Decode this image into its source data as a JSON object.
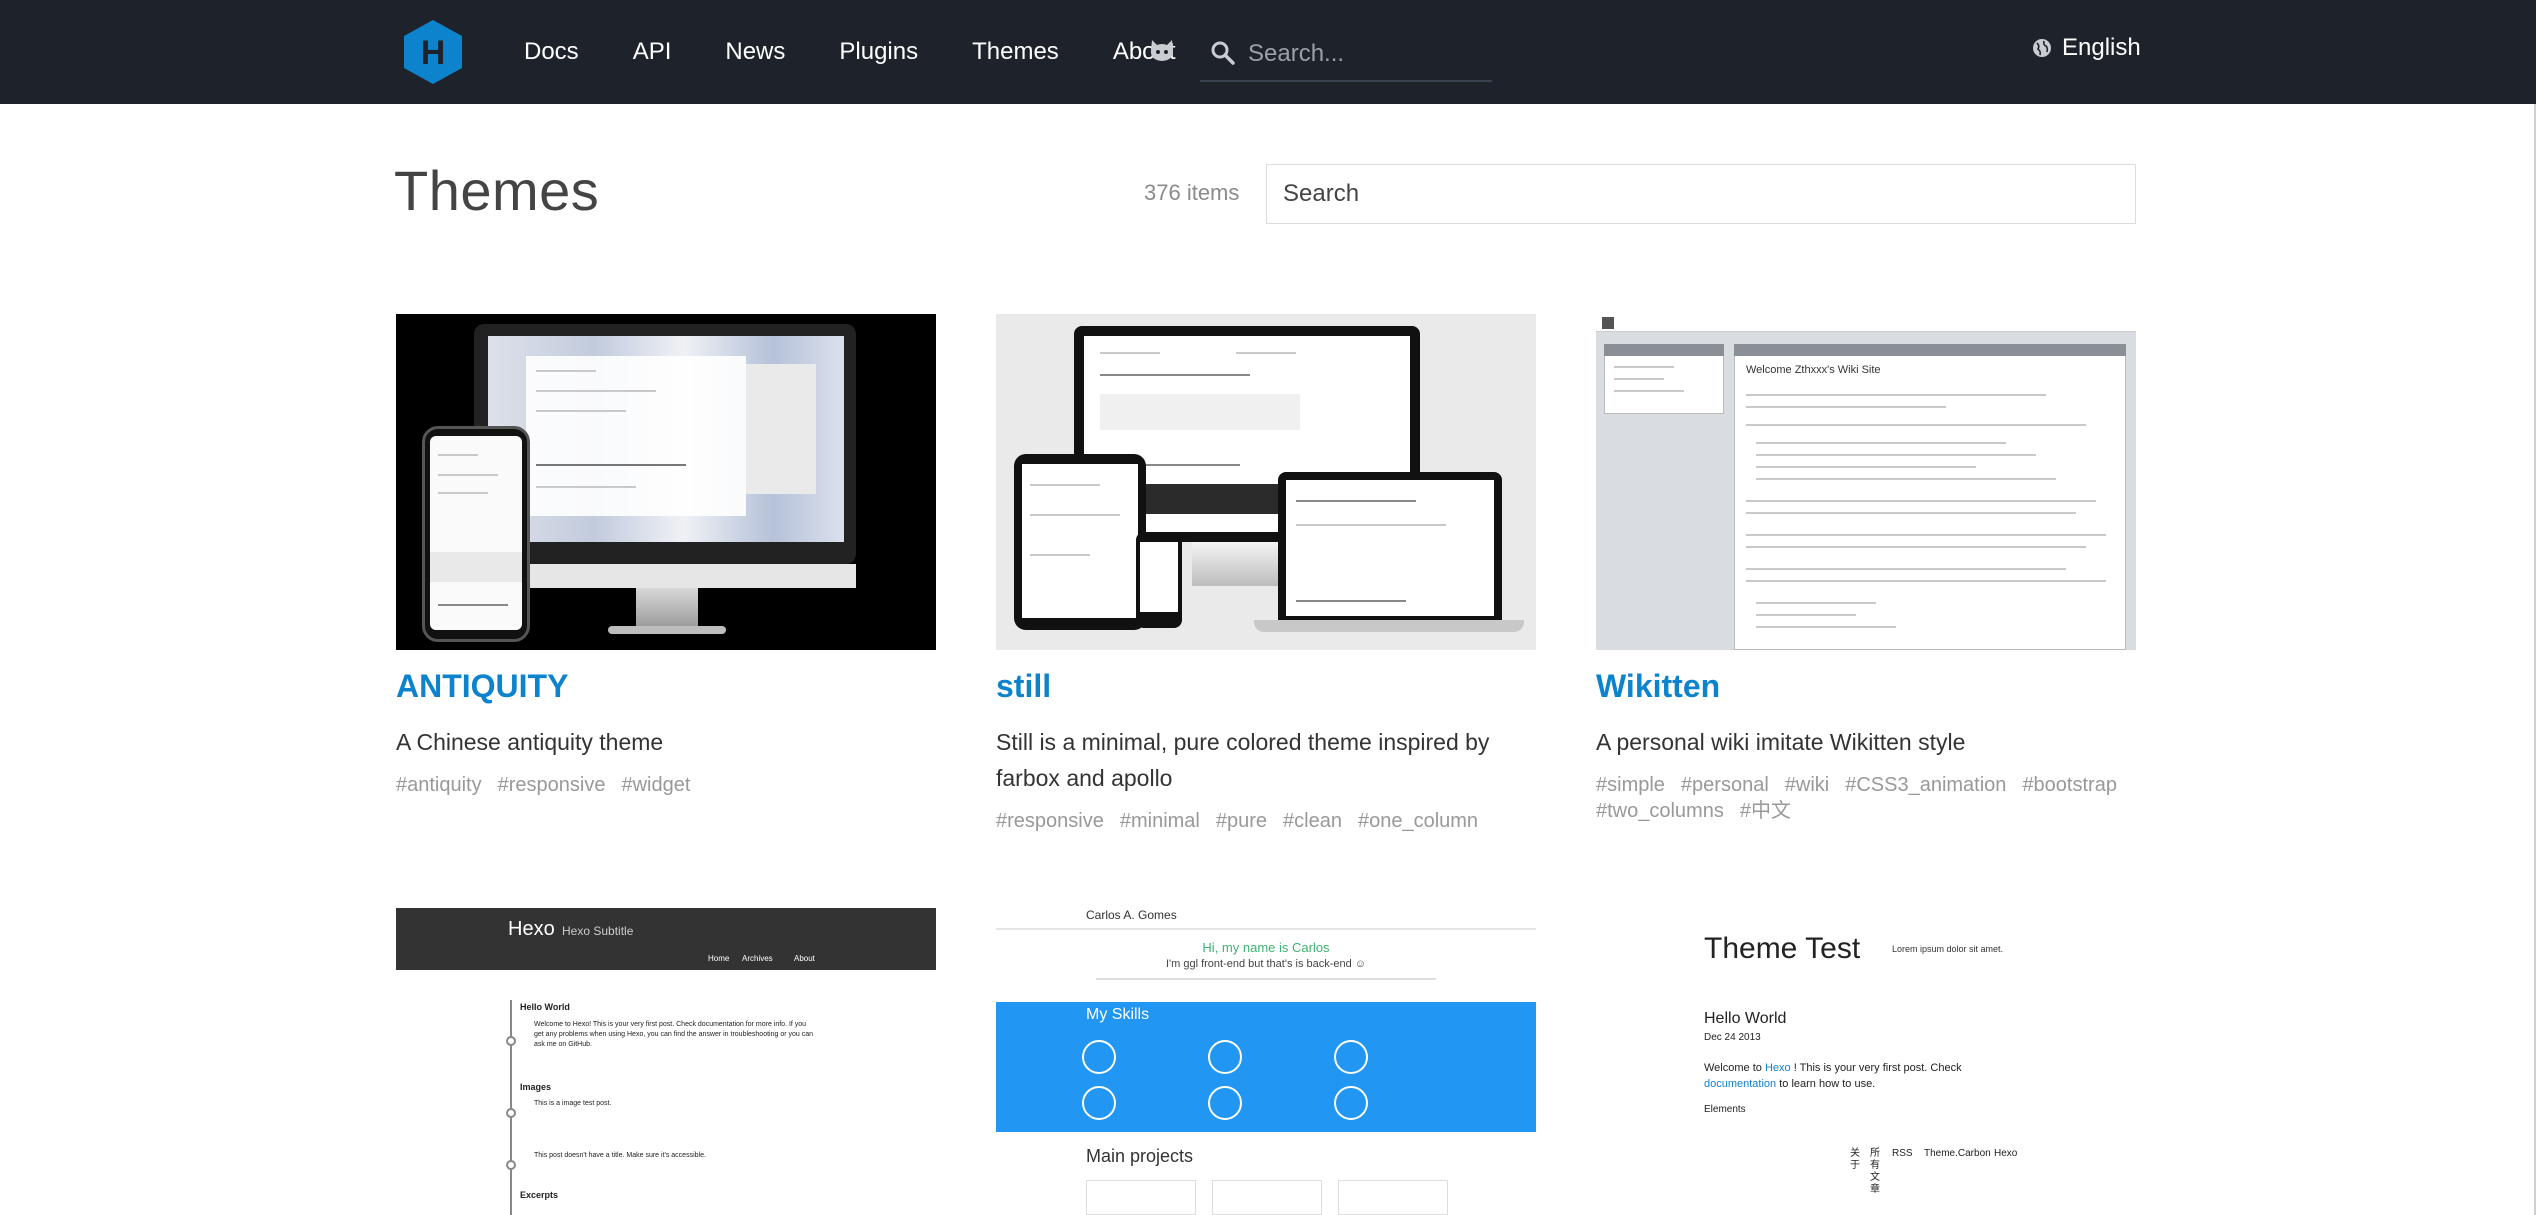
{
  "header": {
    "logo_letter": "H",
    "nav": [
      "Docs",
      "API",
      "News",
      "Plugins",
      "Themes",
      "About"
    ],
    "search_placeholder": "Search...",
    "language": "English"
  },
  "page": {
    "title": "Themes",
    "count": "376 items",
    "search_placeholder": "Search"
  },
  "themes": [
    {
      "name": "ANTIQUITY",
      "description": "A Chinese antiquity theme",
      "tags": [
        "#antiquity",
        "#responsive",
        "#widget"
      ]
    },
    {
      "name": "still",
      "description": "Still is a minimal, pure colored theme inspired by farbox and apollo",
      "tags": [
        "#responsive",
        "#minimal",
        "#pure",
        "#clean",
        "#one_column"
      ]
    },
    {
      "name": "Wikitten",
      "description": "A personal wiki imitate Wikitten style",
      "tags": [
        "#simple",
        "#personal",
        "#wiki",
        "#CSS3_animation",
        "#bootstrap",
        "#two_columns",
        "#中文"
      ]
    }
  ],
  "previews": {
    "wikitten_title": "Welcome Zthxxx's Wiki Site",
    "hexo_title": "Hexo",
    "hexo_subtitle": "Hexo Subtitle",
    "hexo_nav": [
      "Home",
      "Archives",
      "About"
    ],
    "hexo_posts": [
      "Hello World",
      "Images",
      "Excerpts"
    ],
    "hexo_hello_text": "Welcome to Hexo! This is your very first post. Check documentation for more info. If you get any problems when using Hexo, you can find the answer in troubleshooting or you can ask me on GitHub.",
    "hexo_images_text": "This is a image test post.",
    "hexo_untitled_text": "This post doesn't have a title. Make sure it's accessible.",
    "carlos_name": "Carlos A. Gomes",
    "carlos_hi": "Hi, my name is Carlos",
    "carlos_tagline": "I'm ggl front-end but that's is back-end ☺",
    "carlos_skills": "My Skills",
    "carlos_projects": "Main projects",
    "tt_title": "Theme Test",
    "tt_lorem": "Lorem ipsum dolor sit amet.",
    "tt_post": "Hello World",
    "tt_date": "Dec 24 2013",
    "tt_welcome_a": "Welcome to",
    "tt_hexo": "Hexo",
    "tt_welcome_b": "! This is your very first post. Check",
    "tt_doc": "documentation",
    "tt_learn": "to learn how to use.",
    "tt_elements": "Elements",
    "tt_footer": [
      "关于",
      "所有文章",
      "RSS",
      "Theme.Carbon",
      "Hexo"
    ]
  },
  "colors": {
    "header_bg": "#1e232b",
    "link": "#0e83cd",
    "tag": "#999999",
    "logo": "#0e83cd"
  }
}
